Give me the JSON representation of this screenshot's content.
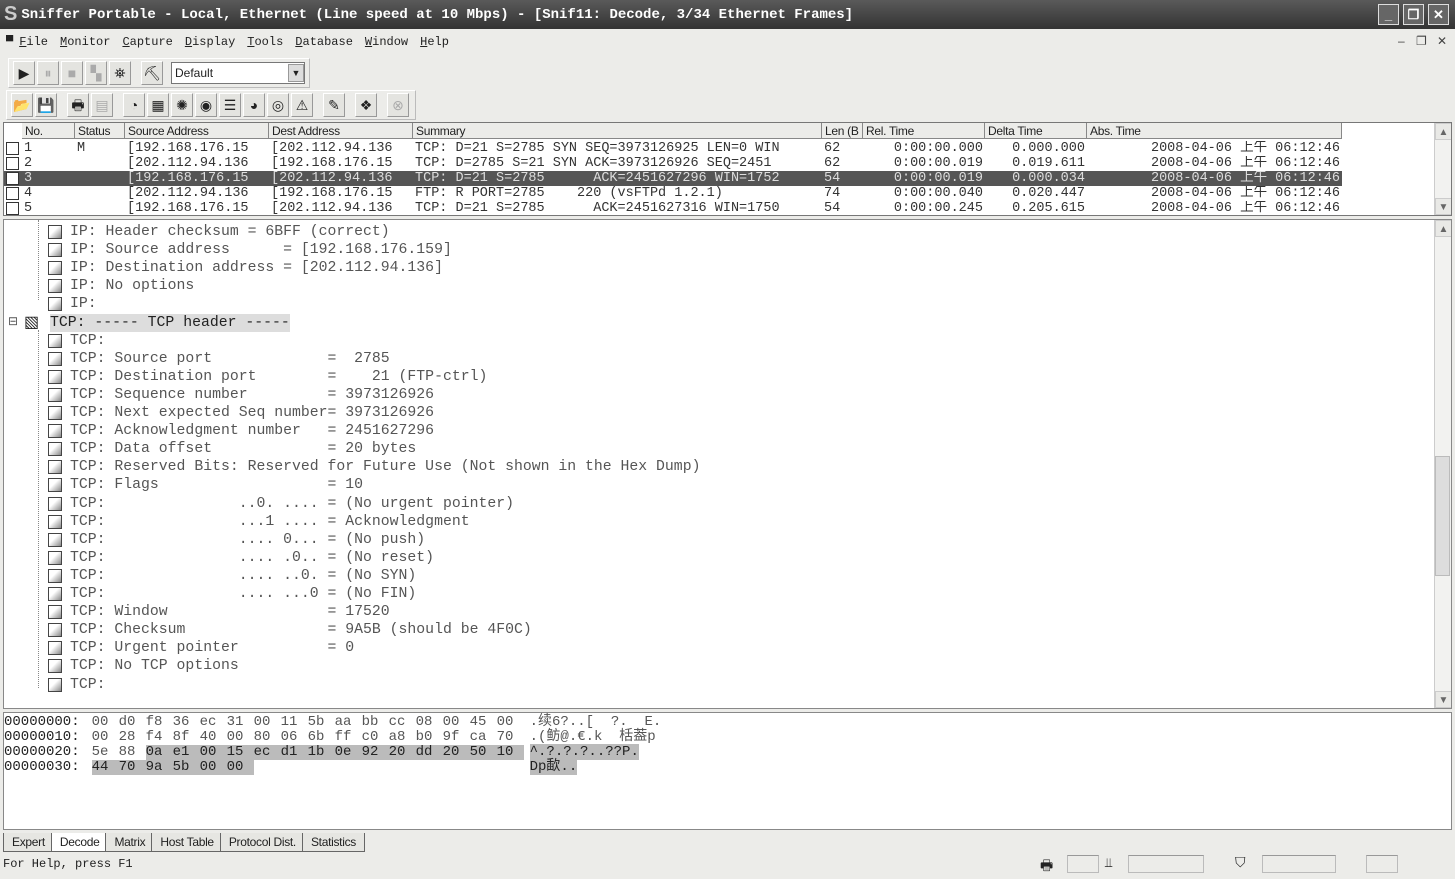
{
  "window": {
    "title": "Sniffer Portable - Local, Ethernet (Line speed at 10 Mbps) - [Snif11: Decode, 3/34 Ethernet Frames]"
  },
  "menu": [
    "File",
    "Monitor",
    "Capture",
    "Display",
    "Tools",
    "Database",
    "Window",
    "Help"
  ],
  "toolbar1": {
    "icons": [
      "play-icon",
      "pause-icon",
      "stop-icon",
      "capture-panel-icon",
      "binoculars-icon",
      "filter-icon"
    ],
    "profile_select": "Default"
  },
  "toolbar2": {
    "icons": [
      "open-icon",
      "save-icon",
      "print-icon",
      "print-preview-icon",
      "dashboard-icon",
      "host-table-icon",
      "matrix-icon",
      "art-icon",
      "history-icon",
      "protocol-dist-icon",
      "global-stats-icon",
      "alarm-log-icon",
      "address-book-icon",
      "packet-generator-icon",
      "stop-all-icon"
    ]
  },
  "packet_list": {
    "columns": [
      "No.",
      "Status",
      "Source Address",
      "Dest Address",
      "Summary",
      "Len (B",
      "Rel. Time",
      "Delta Time",
      "Abs. Time"
    ],
    "rows": [
      [
        "1",
        "M",
        "[192.168.176.15",
        "[202.112.94.136",
        "TCP: D=21 S=2785 SYN SEQ=3973126925 LEN=0 WIN",
        "62",
        "0:00:00.000",
        "0.000.000",
        "2008-04-06 上午 06:12:46"
      ],
      [
        "2",
        "",
        "[202.112.94.136",
        "[192.168.176.15",
        "TCP: D=2785 S=21 SYN ACK=3973126926 SEQ=2451",
        "62",
        "0:00:00.019",
        "0.019.611",
        "2008-04-06 上午 06:12:46"
      ],
      [
        "3",
        "",
        "[192.168.176.15",
        "[202.112.94.136",
        "TCP: D=21 S=2785      ACK=2451627296 WIN=1752",
        "54",
        "0:00:00.019",
        "0.000.034",
        "2008-04-06 上午 06:12:46"
      ],
      [
        "4",
        "",
        "[202.112.94.136",
        "[192.168.176.15",
        "FTP: R PORT=2785    220 (vsFTPd 1.2.1)",
        "74",
        "0:00:00.040",
        "0.020.447",
        "2008-04-06 上午 06:12:46"
      ],
      [
        "5",
        "",
        "[192.168.176.15",
        "[202.112.94.136",
        "TCP: D=21 S=2785      ACK=2451627316 WIN=1750",
        "54",
        "0:00:00.245",
        "0.205.615",
        "2008-04-06 上午 06:12:46"
      ]
    ],
    "selected_row": 3
  },
  "decode": {
    "lines": [
      "IP: Header checksum = 6BFF (correct)",
      "IP: Source address      = [192.168.176.159]",
      "IP: Destination address = [202.112.94.136]",
      "IP: No options",
      "IP:",
      "TCP: ----- TCP header -----",
      "TCP:",
      "TCP: Source port             =  2785",
      "TCP: Destination port        =    21 (FTP-ctrl)",
      "TCP: Sequence number         = 3973126926",
      "TCP: Next expected Seq number= 3973126926",
      "TCP: Acknowledgment number   = 2451627296",
      "TCP: Data offset             = 20 bytes",
      "TCP: Reserved Bits: Reserved for Future Use (Not shown in the Hex Dump)",
      "TCP: Flags                   = 10",
      "TCP:               ..0. .... = (No urgent pointer)",
      "TCP:               ...1 .... = Acknowledgment",
      "TCP:               .... 0... = (No push)",
      "TCP:               .... .0.. = (No reset)",
      "TCP:               .... ..0. = (No SYN)",
      "TCP:               .... ...0 = (No FIN)",
      "TCP: Window                  = 17520",
      "TCP: Checksum                = 9A5B (should be 4F0C)",
      "TCP: Urgent pointer          = 0",
      "TCP: No TCP options",
      "TCP:"
    ],
    "header_line": 5
  },
  "hex": {
    "rows": [
      {
        "offset": "00000000:",
        "bytes": [
          "00",
          "d0",
          "f8",
          "36",
          "ec",
          "31",
          "00",
          "11",
          "5b",
          "aa",
          "bb",
          "cc",
          "08",
          "00",
          "45",
          "00"
        ],
        "ascii": ".续6?..[  ?.  E.",
        "hl_from": 16
      },
      {
        "offset": "00000010:",
        "bytes": [
          "00",
          "28",
          "f4",
          "8f",
          "40",
          "00",
          "80",
          "06",
          "6b",
          "ff",
          "c0",
          "a8",
          "b0",
          "9f",
          "ca",
          "70"
        ],
        "ascii": ".(鲂@.€.k  栝葢p",
        "hl_from": 16
      },
      {
        "offset": "00000020:",
        "bytes": [
          "5e",
          "88",
          "0a",
          "e1",
          "00",
          "15",
          "ec",
          "d1",
          "1b",
          "0e",
          "92",
          "20",
          "dd",
          "20",
          "50",
          "10"
        ],
        "ascii": "^.?.?.?..??P.",
        "hl_from": 2
      },
      {
        "offset": "00000030:",
        "bytes": [
          "44",
          "70",
          "9a",
          "5b",
          "00",
          "00"
        ],
        "ascii": "Dp歃..",
        "hl_from": 0
      }
    ]
  },
  "tabs": [
    "Expert",
    "Decode",
    "Matrix",
    "Host Table",
    "Protocol Dist.",
    "Statistics"
  ],
  "active_tab": "Decode",
  "status": {
    "text": "For Help, press F1"
  }
}
